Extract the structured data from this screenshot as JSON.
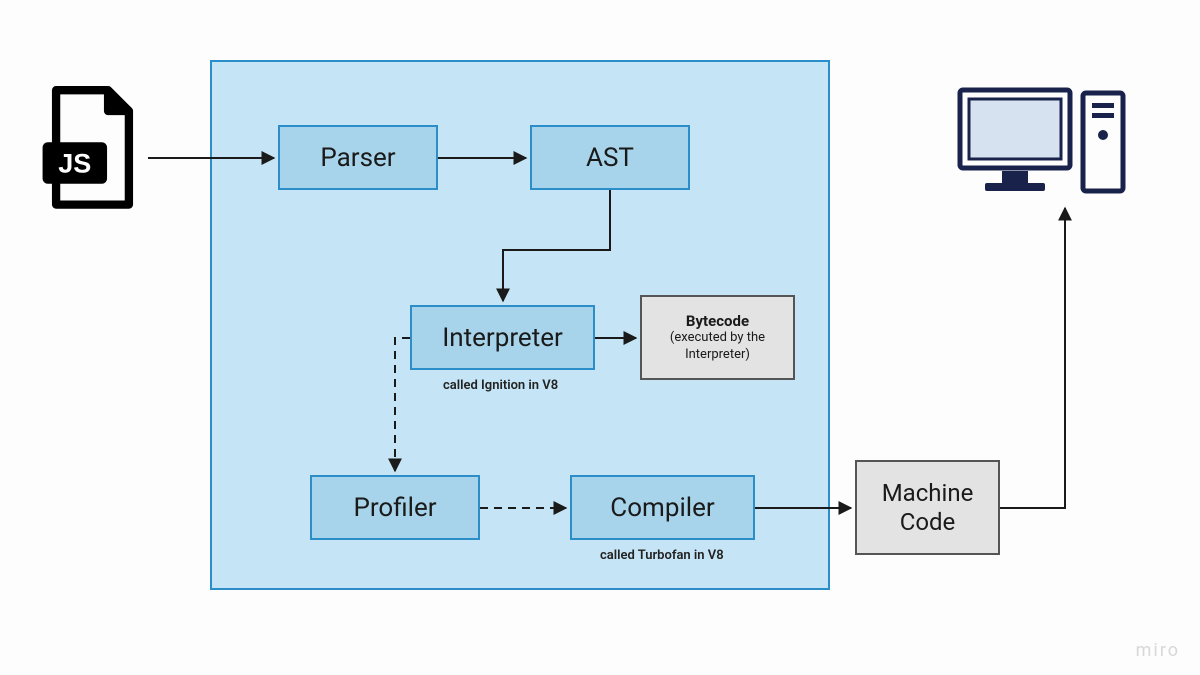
{
  "nodes": {
    "js_file_label": "JS",
    "parser": "Parser",
    "ast": "AST",
    "interpreter": "Interpreter",
    "interpreter_caption": "called Ignition in V8",
    "bytecode_title": "Bytecode",
    "bytecode_sub": "(executed by the Interpreter)",
    "profiler": "Profiler",
    "compiler": "Compiler",
    "compiler_caption": "called Turbofan in V8",
    "machine_code": "Machine Code"
  },
  "watermark": "miro",
  "edges": [
    {
      "from": "js-file",
      "to": "parser",
      "style": "solid"
    },
    {
      "from": "parser",
      "to": "ast",
      "style": "solid"
    },
    {
      "from": "ast",
      "to": "interpreter",
      "style": "solid"
    },
    {
      "from": "interpreter",
      "to": "bytecode",
      "style": "solid"
    },
    {
      "from": "interpreter",
      "to": "profiler",
      "style": "dashed"
    },
    {
      "from": "profiler",
      "to": "compiler",
      "style": "dashed"
    },
    {
      "from": "compiler",
      "to": "machine-code",
      "style": "solid"
    },
    {
      "from": "machine-code",
      "to": "computer",
      "style": "solid"
    }
  ]
}
